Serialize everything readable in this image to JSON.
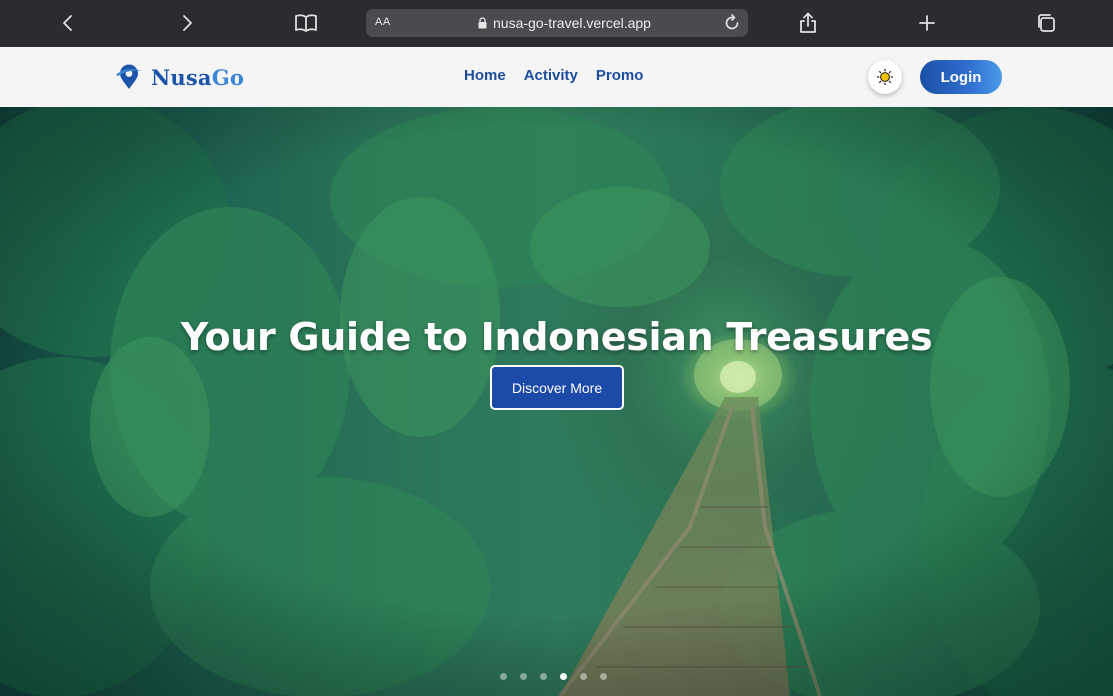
{
  "browser": {
    "aa_label": "AA",
    "url": "nusa-go-travel.vercel.app"
  },
  "header": {
    "logo": {
      "part1": "Nusa",
      "part2": "Go"
    },
    "nav": [
      "Home",
      "Activity",
      "Promo"
    ],
    "login_label": "Login"
  },
  "hero": {
    "title": "Your Guide to Indonesian Treasures",
    "cta_label": "Discover More",
    "slides_count": 6,
    "active_slide": 4
  },
  "colors": {
    "brand_blue": "#1c4aa8",
    "nav_text": "#1d4e9d",
    "browser_bg": "#2b2c2f"
  },
  "icons": [
    "back-icon",
    "forward-icon",
    "bookmarks-icon",
    "lock-icon",
    "reload-icon",
    "share-icon",
    "new-tab-icon",
    "tabs-icon",
    "logo-pin-icon",
    "sun-icon"
  ]
}
